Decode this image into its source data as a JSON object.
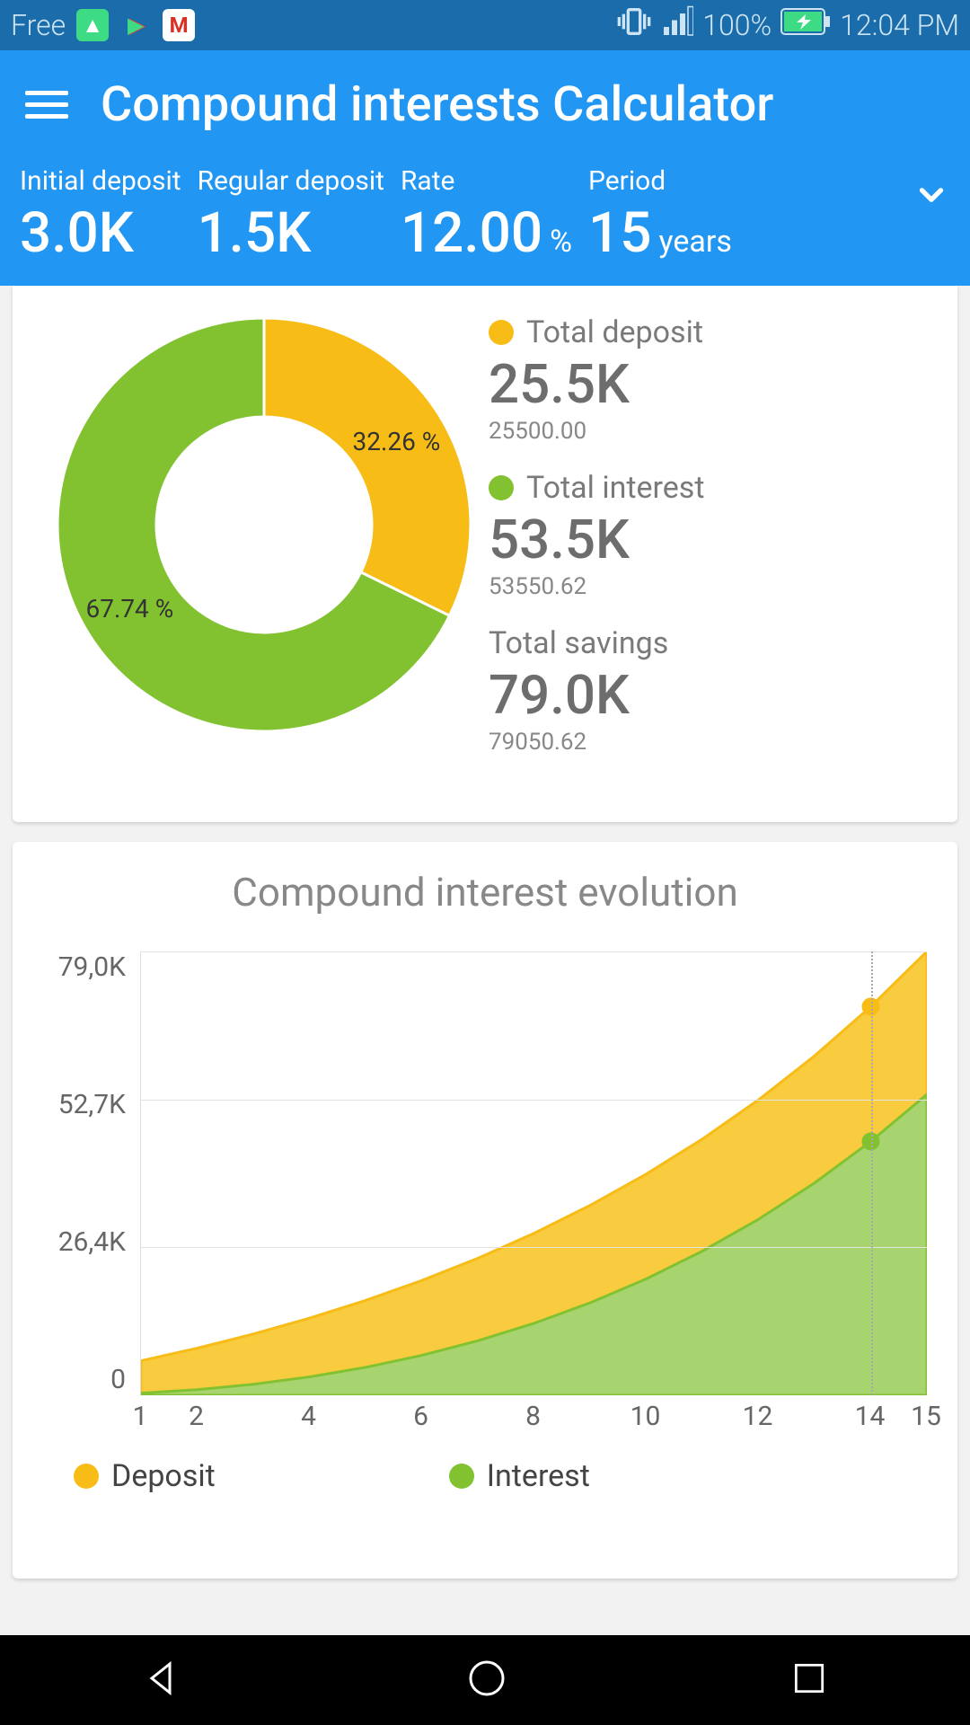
{
  "status_bar": {
    "carrier": "Free",
    "battery_pct": "100%",
    "time": "12:04 PM"
  },
  "header": {
    "title": "Compound interests Calculator"
  },
  "params": {
    "initial_label": "Initial deposit",
    "initial_value": "3.0K",
    "regular_label": "Regular deposit",
    "regular_value": "1.5K",
    "rate_label": "Rate",
    "rate_value": "12.00",
    "rate_unit": "%",
    "period_label": "Period",
    "period_value": "15",
    "period_unit": "years"
  },
  "summary": {
    "deposit_label": "Total deposit",
    "deposit_big": "25.5K",
    "deposit_small": "25500.00",
    "interest_label": "Total interest",
    "interest_big": "53.5K",
    "interest_small": "53550.62",
    "savings_label": "Total savings",
    "savings_big": "79.0K",
    "savings_small": "79050.62"
  },
  "chart2": {
    "title": "Compound interest evolution",
    "legend_deposit": "Deposit",
    "legend_interest": "Interest"
  },
  "colors": {
    "yellow": "#f7bc16",
    "green": "#82c231",
    "green_area": "#a7d46e"
  },
  "chart_data": [
    {
      "type": "pie",
      "title": "Deposit vs Interest share",
      "series": [
        {
          "name": "Total deposit",
          "value": 32.26,
          "label": "32.26 %",
          "color": "#f7bc16"
        },
        {
          "name": "Total interest",
          "value": 67.74,
          "label": "67.74 %",
          "color": "#82c231"
        }
      ]
    },
    {
      "type": "area",
      "title": "Compound interest evolution",
      "xlabel": "",
      "ylabel": "",
      "x": [
        1,
        2,
        3,
        4,
        5,
        6,
        7,
        8,
        9,
        10,
        11,
        12,
        13,
        14,
        15
      ],
      "ylim": [
        0,
        79000
      ],
      "y_ticks": [
        "0",
        "26,4K",
        "52,7K",
        "79,0K"
      ],
      "x_ticks": [
        1,
        2,
        4,
        6,
        8,
        10,
        12,
        14,
        15
      ],
      "marker_x": 14,
      "series": [
        {
          "name": "Deposit",
          "color": "#f7bc16",
          "values": [
            4860,
            6643,
            8640,
            10877,
            13382,
            16188,
            19331,
            22851,
            26793,
            31208,
            36153,
            41692,
            47895,
            54842,
            62624
          ]
        },
        {
          "name": "Interest",
          "color": "#82c231",
          "values": [
            360,
            943,
            1840,
            3077,
            4682,
            6688,
            9131,
            12051,
            15493,
            19508,
            24153,
            29492,
            35595,
            42542,
            50424
          ]
        }
      ]
    }
  ]
}
